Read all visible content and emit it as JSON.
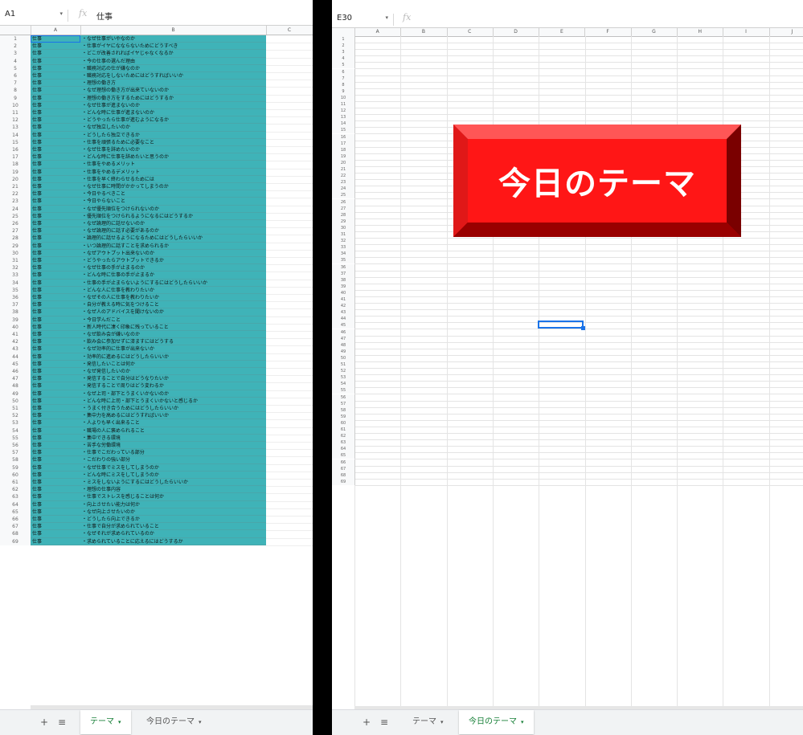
{
  "left": {
    "name_box": "A1",
    "fx": "fx",
    "formula_value": "仕事",
    "columns": [
      "A",
      "B",
      "C"
    ],
    "rows": [
      [
        "1",
        "仕事",
        "・なぜ仕事がいやなのか"
      ],
      [
        "2",
        "仕事",
        "・仕事がイヤになならないためにどうすべき"
      ],
      [
        "3",
        "仕事",
        "・どこが改善されればイヤじゃなくなるか"
      ],
      [
        "4",
        "仕事",
        "・今の仕事の選んだ理由"
      ],
      [
        "5",
        "仕事",
        "・職務対応の仕が嫌なのか"
      ],
      [
        "6",
        "仕事",
        "・職務対応をしないためにはどうすればいいか"
      ],
      [
        "7",
        "仕事",
        "・理想の働き方"
      ],
      [
        "8",
        "仕事",
        "・なぜ理想の働き方が出来ていないのか"
      ],
      [
        "9",
        "仕事",
        "・理想の働き方をするためにはどうするか"
      ],
      [
        "10",
        "仕事",
        "・なぜ仕事が進まないのか"
      ],
      [
        "11",
        "仕事",
        "・どんな時に仕事が進まないのか"
      ],
      [
        "12",
        "仕事",
        "・どうやったら仕事が進むようになるか"
      ],
      [
        "13",
        "仕事",
        "・なぜ独立したいのか"
      ],
      [
        "14",
        "仕事",
        "・どうしたら独立できるか"
      ],
      [
        "15",
        "仕事",
        "・仕事を頑張るために必要なこと"
      ],
      [
        "16",
        "仕事",
        "・なぜ仕事を辞めたいのか"
      ],
      [
        "17",
        "仕事",
        "・どんな時に仕事を辞めたいと思うのか"
      ],
      [
        "18",
        "仕事",
        "・仕事をやめるメリット"
      ],
      [
        "19",
        "仕事",
        "・仕事をやめるデメリット"
      ],
      [
        "20",
        "仕事",
        "・仕事を早く終わらせるためには"
      ],
      [
        "21",
        "仕事",
        "・なぜ仕事に時間がかかってしまうのか"
      ],
      [
        "22",
        "仕事",
        "・今日やるべきこと"
      ],
      [
        "23",
        "仕事",
        "・今日やらないこと"
      ],
      [
        "24",
        "仕事",
        "・なぜ優先順位をつけられないのか"
      ],
      [
        "25",
        "仕事",
        "・優先順位をつけられるようになるにはどうするか"
      ],
      [
        "26",
        "仕事",
        "・なぜ論理的に話せないのか"
      ],
      [
        "27",
        "仕事",
        "・なぜ論理的に話す必要があるのか"
      ],
      [
        "28",
        "仕事",
        "・論理的に話せるようになるためにはどうしたらいいか"
      ],
      [
        "29",
        "仕事",
        "・いつ論理的に話すことを求められるか"
      ],
      [
        "30",
        "仕事",
        "・なぜアウトプット出来ないのか"
      ],
      [
        "31",
        "仕事",
        "・どうやったらアウトプットできるか"
      ],
      [
        "32",
        "仕事",
        "・なぜ仕事の手が止まるのか"
      ],
      [
        "33",
        "仕事",
        "・どんな時に仕事の手が止まるか"
      ],
      [
        "34",
        "仕事",
        "・仕事の手が止まらないようにするにはどうしたらいいか"
      ],
      [
        "35",
        "仕事",
        "・どんな人に仕事を教わりたいか"
      ],
      [
        "36",
        "仕事",
        "・なぜその人に仕事を教わりたいか"
      ],
      [
        "37",
        "仕事",
        "・自分が教える時に気をつけること"
      ],
      [
        "38",
        "仕事",
        "・なぜ人のアドバイスを聞けないのか"
      ],
      [
        "39",
        "仕事",
        "・今日学んだこと"
      ],
      [
        "40",
        "仕事",
        "・新人時代に凄く印象に残っていること"
      ],
      [
        "41",
        "仕事",
        "・なぜ飲み会が嫌いなのか"
      ],
      [
        "42",
        "仕事",
        "・飲み会に参加せずに済ますにはどうする"
      ],
      [
        "43",
        "仕事",
        "・なぜ効率的に仕事が出来ないか"
      ],
      [
        "44",
        "仕事",
        "・効率的に進めるにはどうしたらいいか"
      ],
      [
        "45",
        "仕事",
        "・発信したいことは何か"
      ],
      [
        "46",
        "仕事",
        "・なぜ発信したいのか"
      ],
      [
        "47",
        "仕事",
        "・発信することで自分はどうなりたいか"
      ],
      [
        "48",
        "仕事",
        "・発信することで周りはどう変わるか"
      ],
      [
        "49",
        "仕事",
        "・なぜ上司・部下とうまくいかないのか"
      ],
      [
        "50",
        "仕事",
        "・どんな時に上司・部下とうまくいかないと感じるか"
      ],
      [
        "51",
        "仕事",
        "・うまく付き合うためにはどうしたらいいか"
      ],
      [
        "52",
        "仕事",
        "・集中力を高めるにはどうすればいいか"
      ],
      [
        "53",
        "仕事",
        "・人よりも早く出来ること"
      ],
      [
        "54",
        "仕事",
        "・職場の人に褒められること"
      ],
      [
        "55",
        "仕事",
        "・集中できる環境"
      ],
      [
        "56",
        "仕事",
        "・苦手な労働環境"
      ],
      [
        "57",
        "仕事",
        "・仕事でこだわっている部分"
      ],
      [
        "58",
        "仕事",
        "・こだわりの強い部分"
      ],
      [
        "59",
        "仕事",
        "・なぜ仕事でミスをしてしまうのか"
      ],
      [
        "60",
        "仕事",
        "・どんな時にミスをしてしまうのか"
      ],
      [
        "61",
        "仕事",
        "・ミスをしないようにするにはどうしたらいいか"
      ],
      [
        "62",
        "仕事",
        "・理想の仕事内容"
      ],
      [
        "63",
        "仕事",
        "・仕事でストレスを感じることは何か"
      ],
      [
        "64",
        "仕事",
        "・向上させたい能力は何か"
      ],
      [
        "65",
        "仕事",
        "・なぜ向上させたいのか"
      ],
      [
        "66",
        "仕事",
        "・どうしたら向上できるか"
      ],
      [
        "67",
        "仕事",
        "・仕事で自分が求められていること"
      ],
      [
        "68",
        "仕事",
        "・なぜそれが求められているのか"
      ],
      [
        "69",
        "仕事",
        "・求められていることに応えるにはどうするか"
      ]
    ],
    "tabs": [
      {
        "label": "テーマ",
        "active": true
      },
      {
        "label": "今日のテーマ",
        "active": false
      }
    ]
  },
  "right": {
    "name_box": "E30",
    "fx": "fx",
    "columns": [
      "A",
      "B",
      "C",
      "D",
      "E",
      "F",
      "G",
      "H",
      "I",
      "J"
    ],
    "row_count": 69,
    "button_label": "今日のテーマ",
    "tabs": [
      {
        "label": "テーマ",
        "active": false
      },
      {
        "label": "今日のテーマ",
        "active": true
      }
    ]
  },
  "icons": {
    "add": "+",
    "menu": "≡",
    "dropdown": "▾"
  }
}
